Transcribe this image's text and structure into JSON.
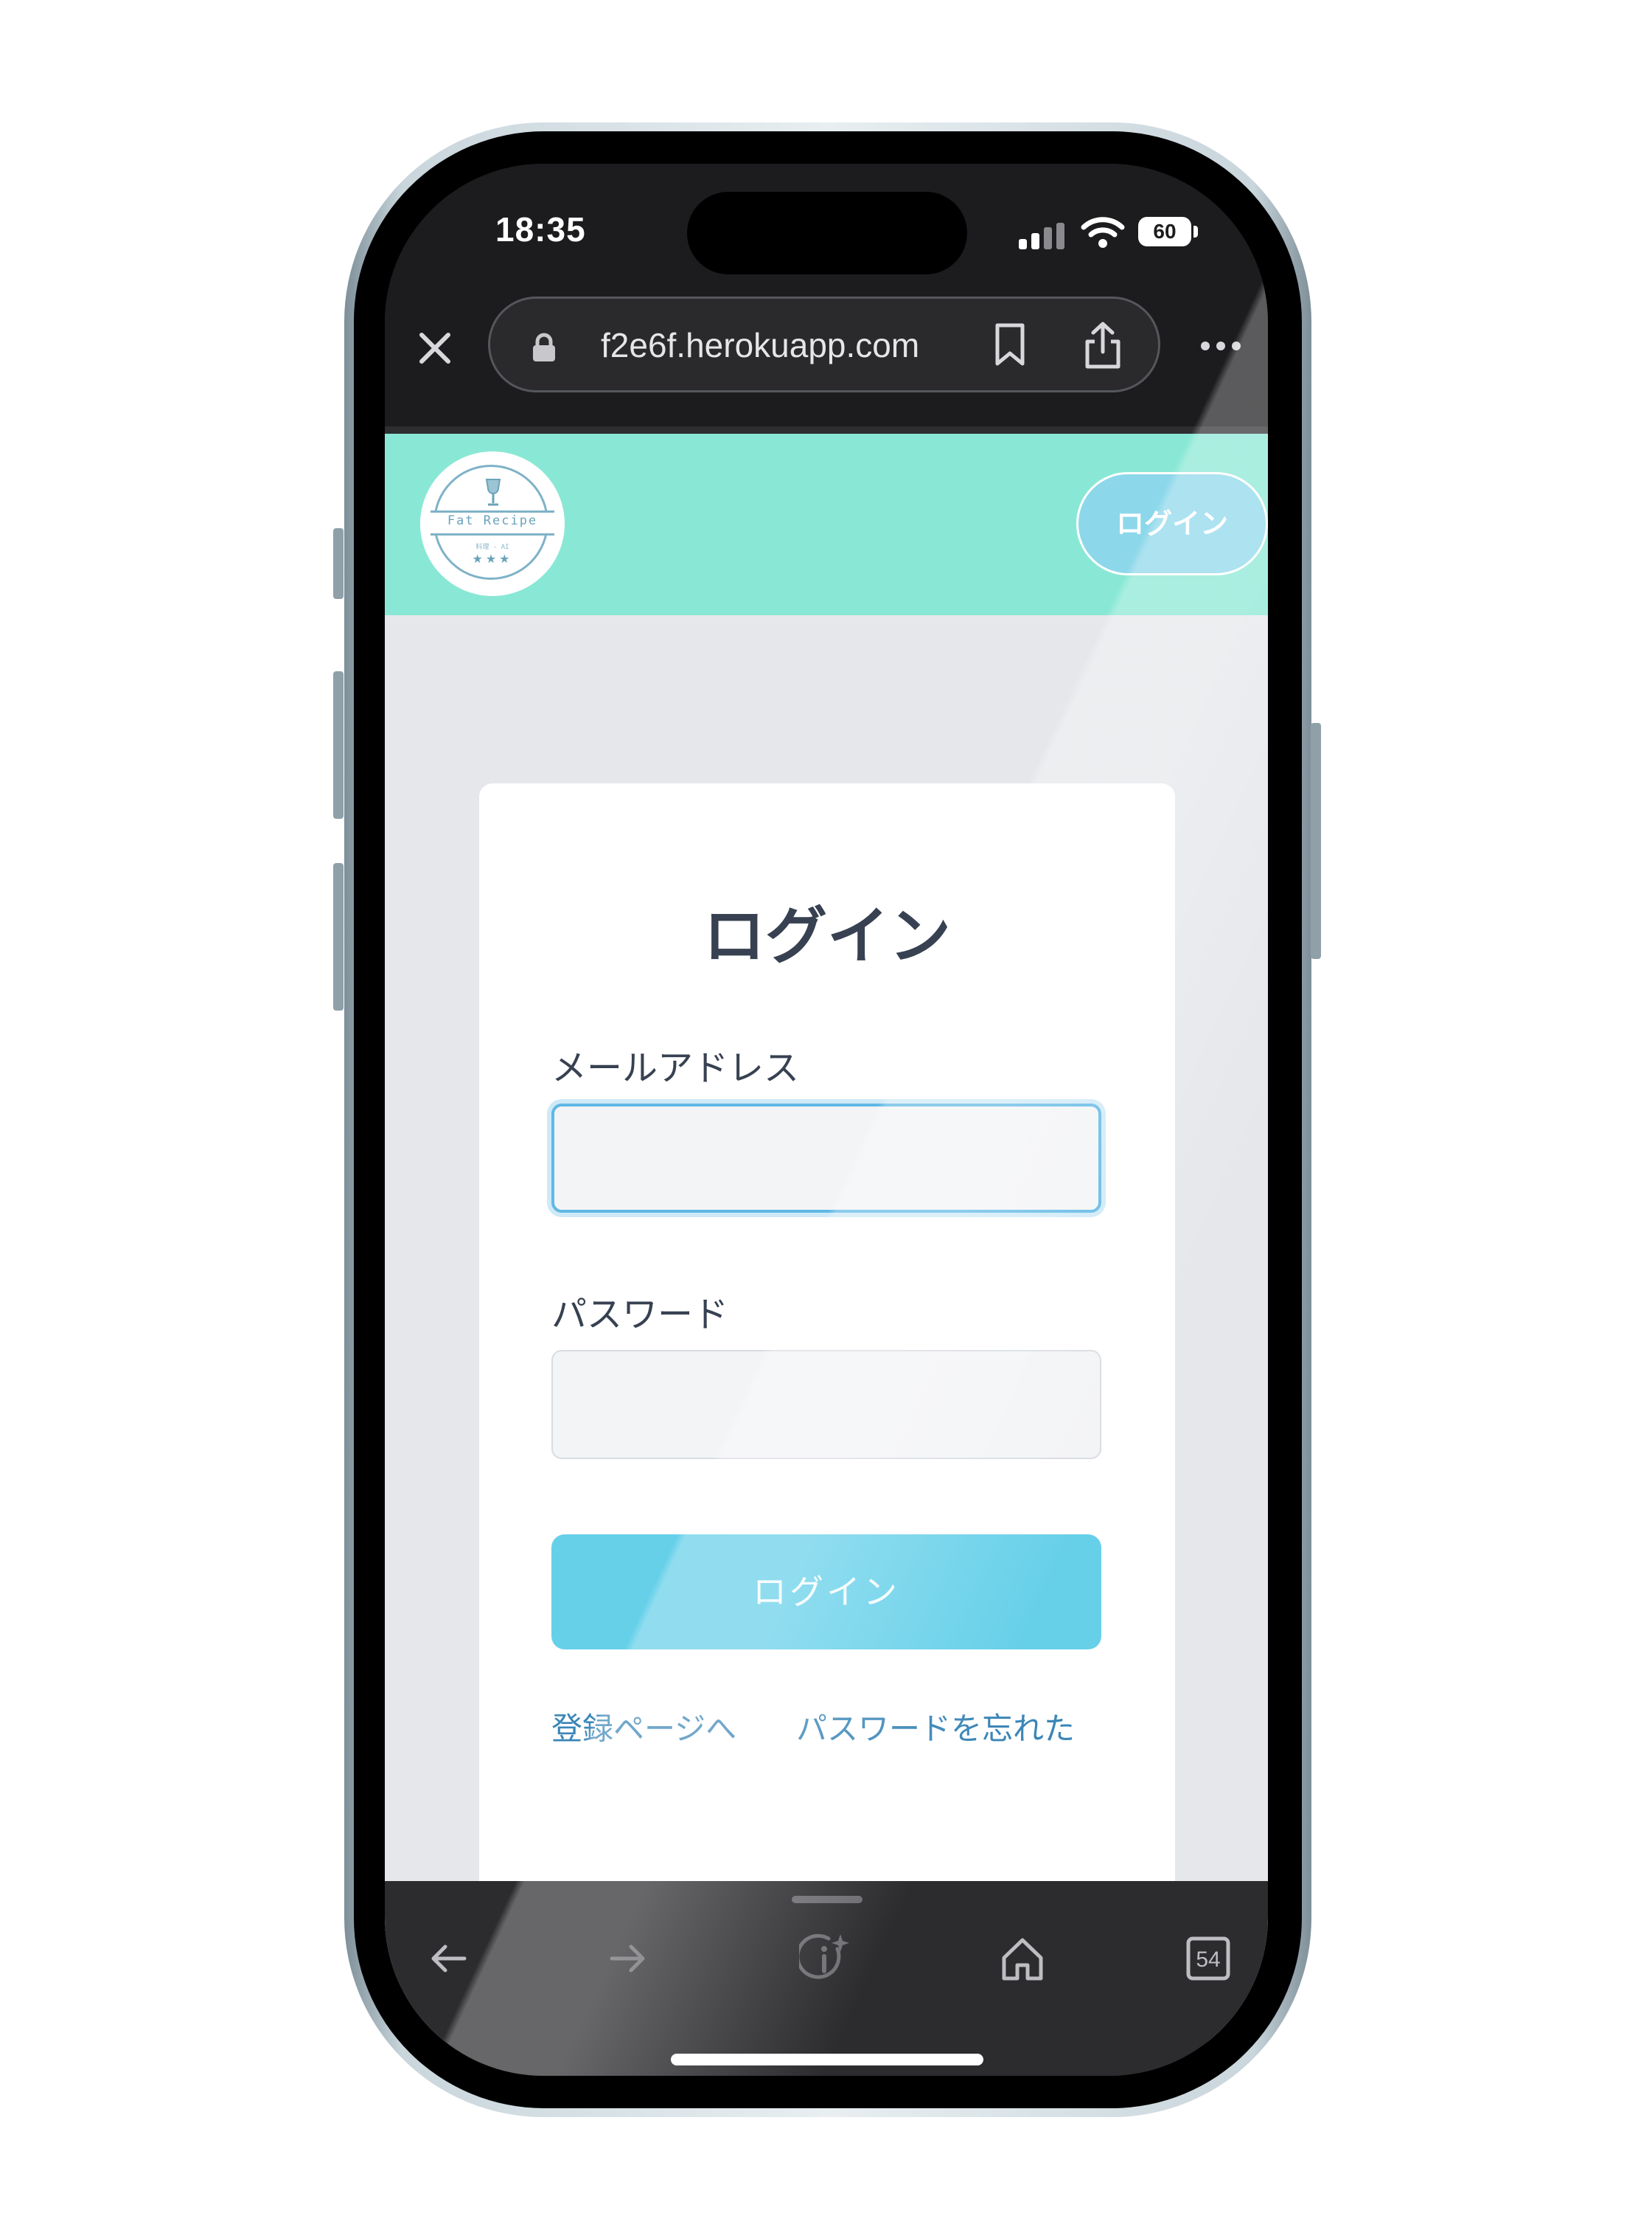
{
  "status_bar": {
    "time": "18:35",
    "battery": "60",
    "icons": [
      "signal-icon",
      "wifi-icon",
      "battery-icon"
    ]
  },
  "browser": {
    "url": "f2e6f.herokuapp.com",
    "icons": [
      "close-icon",
      "lock-icon",
      "bookmark-icon",
      "share-icon",
      "more-icon"
    ]
  },
  "site_header": {
    "logo_text": "Fat Recipe",
    "logo_sub": "料理 - AI",
    "logo_stars": "★★★",
    "login_button": "ログイン"
  },
  "form": {
    "title": "ログイン",
    "email_label": "メールアドレス",
    "email_value": "",
    "password_label": "パスワード",
    "password_value": "",
    "submit_label": "ログイン",
    "register_link": "登録ページへ",
    "forgot_link": "パスワードを忘れた"
  },
  "toolbar": {
    "tabs_count": "54",
    "icons": [
      "back-arrow-icon",
      "forward-arrow-icon",
      "info-sparkle-icon",
      "home-icon",
      "tabs-icon"
    ]
  },
  "colors": {
    "header_bg": "#89e8d5",
    "page_bg": "#e5e7eb",
    "button_bg": "#66d0e9",
    "link": "#3b86b7",
    "focus_ring": "#5fb8e6"
  }
}
